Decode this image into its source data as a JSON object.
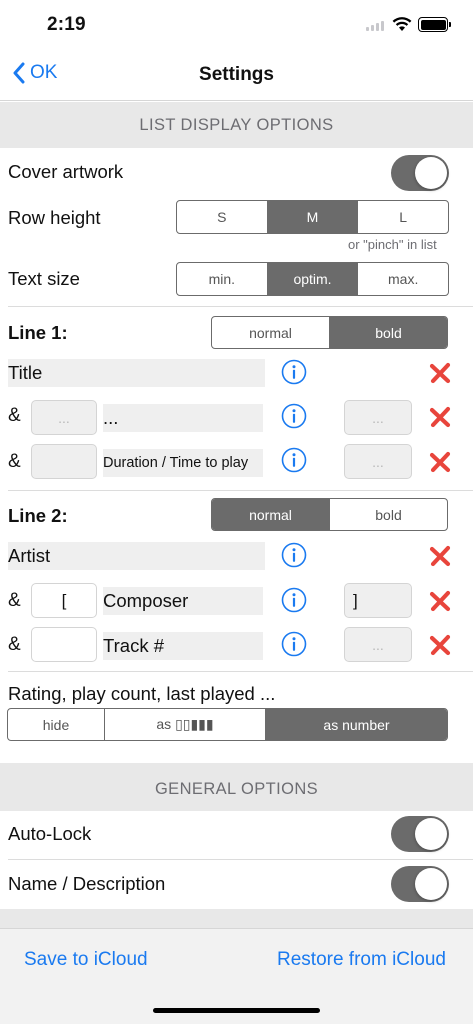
{
  "status": {
    "time": "2:19"
  },
  "nav": {
    "back_label": "OK",
    "title": "Settings"
  },
  "list_display": {
    "header": "LIST DISPLAY OPTIONS",
    "cover_artwork": {
      "label": "Cover artwork",
      "on": true
    },
    "row_height": {
      "label": "Row height",
      "options": [
        "S",
        "M",
        "L"
      ],
      "selected": "M",
      "hint": "or \"pinch\" in list"
    },
    "text_size": {
      "label": "Text size",
      "options": [
        "min.",
        "optim.",
        "max."
      ],
      "selected": "optim."
    },
    "line1": {
      "label": "Line 1:",
      "style_options": [
        "normal",
        "bold"
      ],
      "style_selected": "bold",
      "rows": [
        {
          "amp": "",
          "prefix": "",
          "field": "Title",
          "suffix": ""
        },
        {
          "amp": "&",
          "prefix_placeholder": "...",
          "field": "...",
          "suffix_placeholder": "..."
        },
        {
          "amp": "&",
          "prefix": "",
          "field": "Duration / Time to play",
          "suffix_placeholder": "..."
        }
      ]
    },
    "line2": {
      "label": "Line 2:",
      "style_options": [
        "normal",
        "bold"
      ],
      "style_selected": "normal",
      "rows": [
        {
          "amp": "",
          "field": "Artist"
        },
        {
          "amp": "&",
          "prefix": "[",
          "field": "Composer",
          "suffix": "]"
        },
        {
          "amp": "&",
          "prefix": "",
          "field": "Track #",
          "suffix_placeholder": "..."
        }
      ]
    },
    "rating": {
      "label": "Rating, play count, last played ...",
      "options": [
        "hide",
        "as ▯▯▮▮▮",
        "as number"
      ],
      "selected": "as number"
    }
  },
  "general": {
    "header": "GENERAL OPTIONS",
    "auto_lock": {
      "label": "Auto-Lock",
      "on": true
    },
    "name_description": {
      "label": "Name / Description",
      "on": true
    }
  },
  "bottom": {
    "save": "Save to iCloud",
    "restore": "Restore from iCloud"
  },
  "colors": {
    "accent": "#1a7af0",
    "segment_active": "#6b6b6b",
    "delete": "#e8453c",
    "section_bg": "#e8e8e8"
  },
  "icons": {
    "info": "info-circle-icon",
    "delete": "red-x-icon",
    "back": "chevron-left-icon"
  }
}
